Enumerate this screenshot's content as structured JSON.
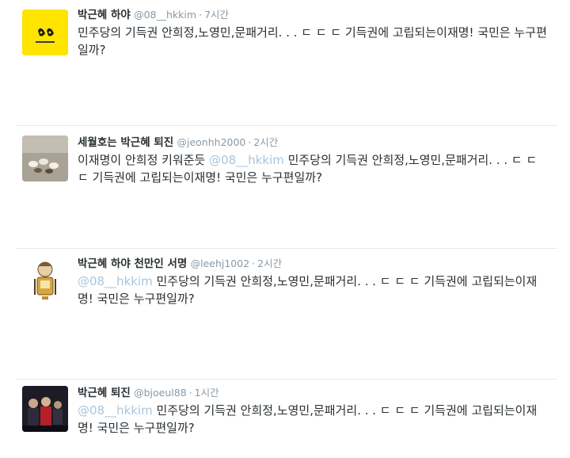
{
  "tweets": [
    {
      "name": "박근혜 하야",
      "handle": "@08__hkkim",
      "dot": "·",
      "time": "7시간",
      "mention": "",
      "text": "민주당의 기득권 안희정,노영민,문패거리. . . ㄷ ㄷ ㄷ 기득권에 고립되는이재명! 국민은 누구편일까?",
      "avatar": "yellow-logo-avatar"
    },
    {
      "name": "세월호는 박근혜 퇴진",
      "handle": "@jeonhh2000",
      "dot": "·",
      "time": "2시간",
      "prefix": "이재명이 안희정 키워준듯 ",
      "mention": "@08__hkkim",
      "text": " 민주당의 기득권 안희정,노영민,문패거리. . . ㄷ ㄷ ㄷ 기득권에 고립되는이재명! 국민은 누구편일까?",
      "avatar": "ducks-photo-avatar"
    },
    {
      "name": "박근혜 하야 천만인 서명",
      "handle": "@leehj1002",
      "dot": "·",
      "time": "2시간",
      "mention": "@08__hkkim",
      "text": " 민주당의 기득권 안희정,노영민,문패거리. . . ㄷ ㄷ ㄷ 기득권에 고립되는이재명! 국민은 누구편일까?",
      "avatar": "cartoon-character-avatar"
    },
    {
      "name": "박근혜 퇴진",
      "handle": "@bjoeul88",
      "dot": "·",
      "time": "1시간",
      "mention": "@08__hkkim",
      "text": " 민주당의 기득권 안희정,노영민,문패거리. . . ㄷ ㄷ ㄷ 기득권에 고립되는이재명! 국민은 누구편일까?",
      "avatar": "crowd-photo-avatar"
    }
  ],
  "colors": {
    "name": "#292f33",
    "meta": "#8899a6",
    "mention": "#a7c6e0",
    "avatar_yellow": "#ffe400"
  }
}
